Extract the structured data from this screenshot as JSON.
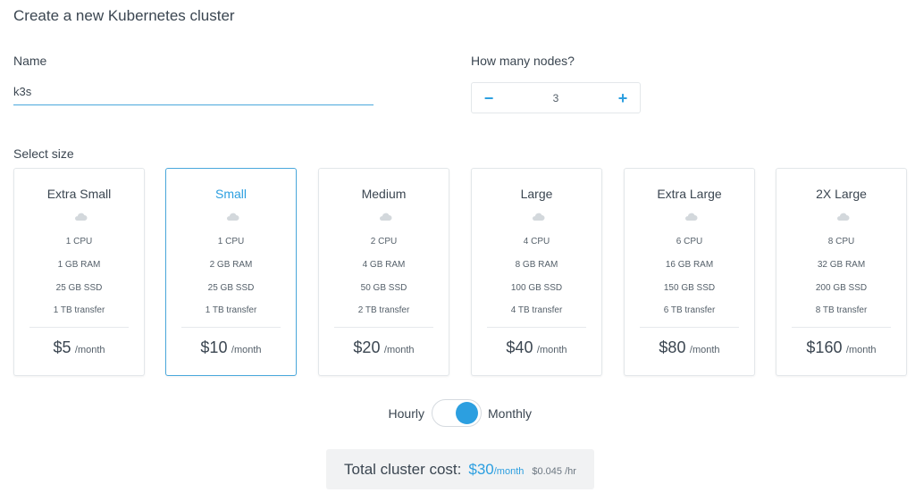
{
  "page": {
    "title": "Create a new Kubernetes cluster"
  },
  "name_field": {
    "label": "Name",
    "value": "k3s"
  },
  "nodes": {
    "label": "How many nodes?",
    "decrement": "−",
    "value": "3",
    "increment": "+"
  },
  "size": {
    "label": "Select size",
    "period": "/month",
    "selected": "Small",
    "plans": [
      {
        "name": "Extra Small",
        "cpu": "1 CPU",
        "ram": "1 GB RAM",
        "ssd": "25 GB SSD",
        "transfer": "1 TB transfer",
        "price": "$5"
      },
      {
        "name": "Small",
        "cpu": "1 CPU",
        "ram": "2 GB RAM",
        "ssd": "25 GB SSD",
        "transfer": "1 TB transfer",
        "price": "$10"
      },
      {
        "name": "Medium",
        "cpu": "2 CPU",
        "ram": "4 GB RAM",
        "ssd": "50 GB SSD",
        "transfer": "2 TB transfer",
        "price": "$20"
      },
      {
        "name": "Large",
        "cpu": "4 CPU",
        "ram": "8 GB RAM",
        "ssd": "100 GB SSD",
        "transfer": "4 TB transfer",
        "price": "$40"
      },
      {
        "name": "Extra Large",
        "cpu": "6 CPU",
        "ram": "16 GB RAM",
        "ssd": "150 GB SSD",
        "transfer": "6 TB transfer",
        "price": "$80"
      },
      {
        "name": "2X Large",
        "cpu": "8 CPU",
        "ram": "32 GB RAM",
        "ssd": "200 GB SSD",
        "transfer": "8 TB transfer",
        "price": "$160"
      }
    ]
  },
  "billing": {
    "left_label": "Hourly",
    "right_label": "Monthly",
    "selected": "Monthly"
  },
  "total": {
    "label": "Total cluster cost:",
    "amount": "$30",
    "period": "/month",
    "hourly": "$0.045 /hr"
  },
  "icons": {
    "plan": "cloud-icon",
    "toggle": "toggle-switch"
  },
  "colors": {
    "accent": "#2c9fe0",
    "text": "#3b4651",
    "border": "#e3e7ea",
    "total_bg": "#f1f2f3"
  }
}
